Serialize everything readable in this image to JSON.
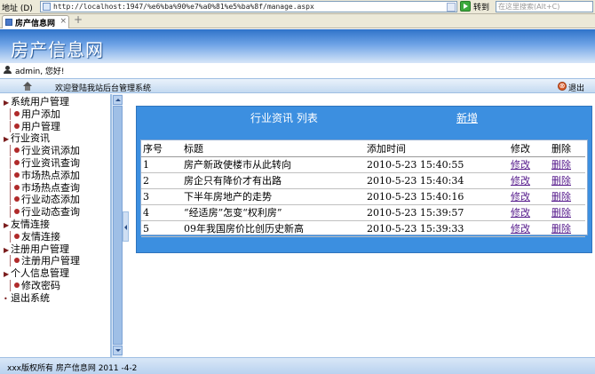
{
  "browser": {
    "address_label": "地址 (D)",
    "url": "http://localhost:1947/%e6%ba%90%e7%a0%81%e5%ba%8f/manage.aspx",
    "go_label": "转到",
    "search_placeholder": "在这里搜索(Alt+C)",
    "tab_title": "房产信息网",
    "tab_close": "×",
    "new_tab": "+"
  },
  "site": {
    "title": "房产信息网",
    "user_greeting": "admin, 您好!",
    "welcome": "欢迎登陆我站后台管理系统",
    "logout_label": "退出",
    "logout_icon": "⊗"
  },
  "sidebar": {
    "items": [
      {
        "label": "系统用户管理",
        "level": 0,
        "marker": "▶"
      },
      {
        "label": "用户添加",
        "level": 1
      },
      {
        "label": "用户管理",
        "level": 1
      },
      {
        "label": "行业资讯",
        "level": 0,
        "marker": "▶"
      },
      {
        "label": "行业资讯添加",
        "level": 1
      },
      {
        "label": "行业资讯查询",
        "level": 1
      },
      {
        "label": "市场热点添加",
        "level": 1
      },
      {
        "label": "市场热点查询",
        "level": 1
      },
      {
        "label": "行业动态添加",
        "level": 1
      },
      {
        "label": "行业动态查询",
        "level": 1
      },
      {
        "label": "友情连接",
        "level": 0,
        "marker": "▶"
      },
      {
        "label": "友情连接",
        "level": 1
      },
      {
        "label": "注册用户管理",
        "level": 0,
        "marker": "▶"
      },
      {
        "label": "注册用户管理",
        "level": 1
      },
      {
        "label": "个人信息管理",
        "level": 0,
        "marker": "▶"
      },
      {
        "label": "修改密码",
        "level": 1
      },
      {
        "label": "退出系统",
        "level": 0,
        "marker": "•"
      }
    ]
  },
  "main": {
    "panel_title": "行业资讯  列表",
    "add_link": "新增",
    "table": {
      "headers": [
        "序号",
        "标题",
        "添加时间",
        "修改",
        "删除"
      ],
      "rows": [
        {
          "no": "1",
          "title": "房产新政使楼市从此转向",
          "time": "2010-5-23 15:40:55",
          "edit": "修改",
          "del": "删除"
        },
        {
          "no": "2",
          "title": "房企只有降价才有出路",
          "time": "2010-5-23 15:40:34",
          "edit": "修改",
          "del": "删除"
        },
        {
          "no": "3",
          "title": "下半年房地产的走势",
          "time": "2010-5-23 15:40:16",
          "edit": "修改",
          "del": "删除"
        },
        {
          "no": "4",
          "title": "“经适房”怎变“权利房”",
          "time": "2010-5-23 15:39:57",
          "edit": "修改",
          "del": "删除"
        },
        {
          "no": "5",
          "title": "09年我国房价比创历史新高",
          "time": "2010-5-23 15:39:33",
          "edit": "修改",
          "del": "删除"
        }
      ]
    }
  },
  "footer": {
    "text": "xxx版权所有  房产信息网  2011 -4-2"
  },
  "colors": {
    "header_blue": "#2f73c9",
    "panel_blue": "#3c8fe0",
    "menu_dark_red": "#7a1d1d",
    "link_purple": "#551a8b"
  }
}
